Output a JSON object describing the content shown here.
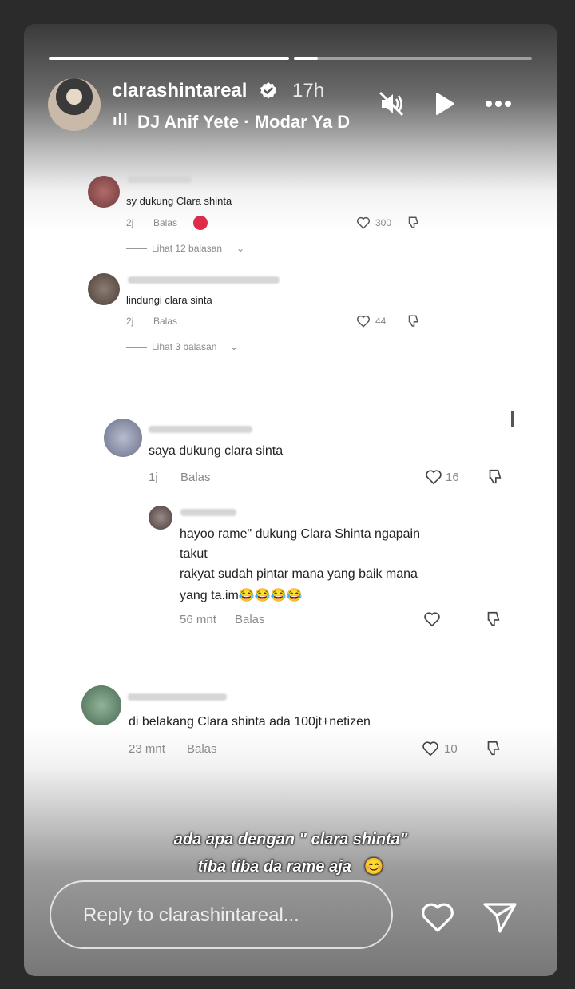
{
  "story": {
    "progress": [
      1.0,
      0.1
    ],
    "username": "clarashintareal",
    "time": "17h",
    "music_bars": "ıll",
    "music": "DJ Anif Yete · Modar Ya D",
    "icons": [
      "mute-icon",
      "play-icon",
      "more-icon"
    ]
  },
  "comments": [
    {
      "text": "sy dukung Clara shinta",
      "time": "2j",
      "reply": "Balas",
      "likes": "300",
      "view_replies": "Lihat 12 balasan"
    },
    {
      "text": "lindungi clara sinta",
      "time": "2j",
      "reply": "Balas",
      "likes": "44",
      "view_replies": "Lihat 3 balasan"
    },
    {
      "text": "saya dukung clara sinta",
      "time": "1j",
      "reply": "Balas",
      "likes": "16"
    },
    {
      "text_lines": [
        "hayoo rame\" dukung Clara Shinta ngapain",
        "takut",
        "rakyat sudah pintar mana yang baik mana",
        "yang ta.im😂😂😂😂"
      ],
      "time": "56 mnt",
      "reply": "Balas"
    },
    {
      "text": "di belakang Clara shinta ada 100jt+netizen",
      "time": "23 mnt",
      "reply": "Balas",
      "likes": "10"
    }
  ],
  "caption": {
    "line1": "ada apa dengan  \" clara shinta\"",
    "line2": "tiba tiba da rame aja",
    "emoji": "😊"
  },
  "reply_bar": {
    "placeholder": "Reply to clarashintareal..."
  }
}
